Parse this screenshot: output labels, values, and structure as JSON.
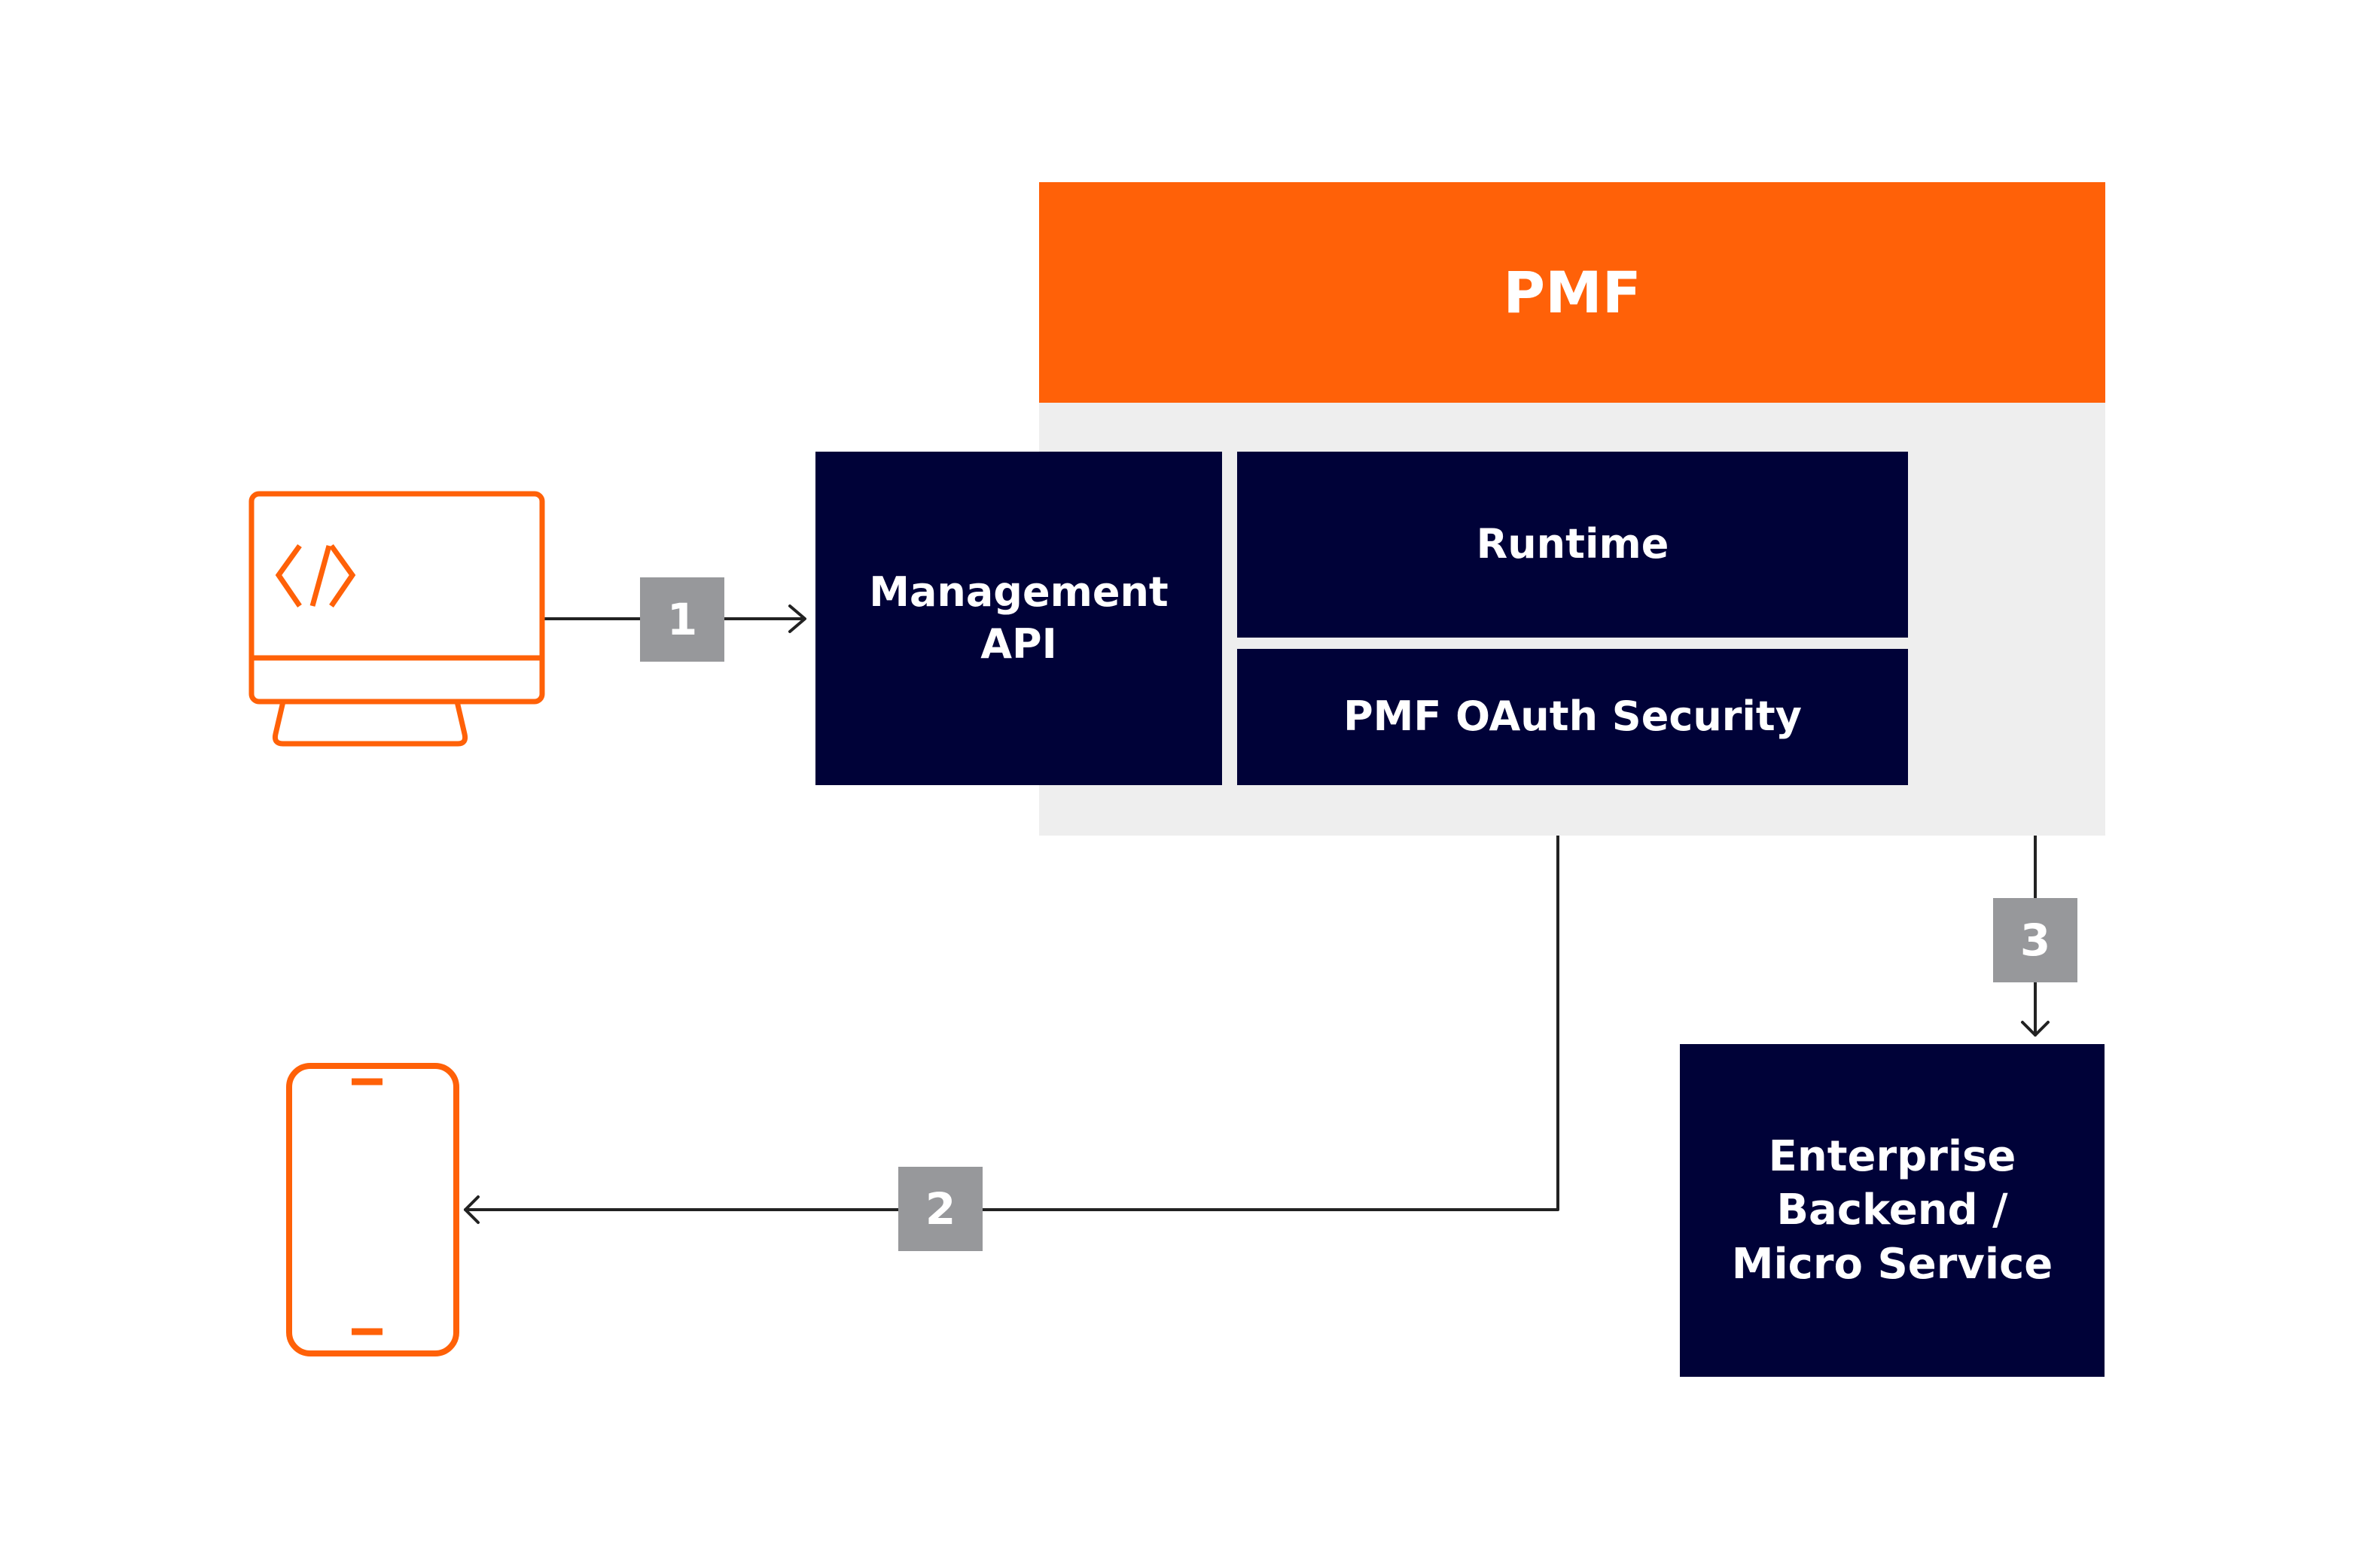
{
  "diagram": {
    "title": "PMF",
    "colors": {
      "brand_orange": "#ff6108",
      "navy": "#000238",
      "panel_grey": "#eeeeee",
      "badge_grey": "#97989b",
      "line": "#222222",
      "white": "#ffffff"
    },
    "nodes": {
      "management_api": "Management API",
      "runtime": "Runtime",
      "oauth_security": "PMF OAuth Security",
      "enterprise_backend": "Enterprise Backend / Micro Service"
    },
    "icons": {
      "developer": "monitor-code-icon",
      "mobile_client": "smartphone-icon"
    },
    "steps": [
      {
        "label": "1",
        "from": "developer",
        "to": "management_api"
      },
      {
        "label": "2",
        "from": "oauth_security",
        "to": "mobile_client"
      },
      {
        "label": "3",
        "from": "runtime",
        "to": "enterprise_backend",
        "bidirectional": true
      }
    ]
  }
}
